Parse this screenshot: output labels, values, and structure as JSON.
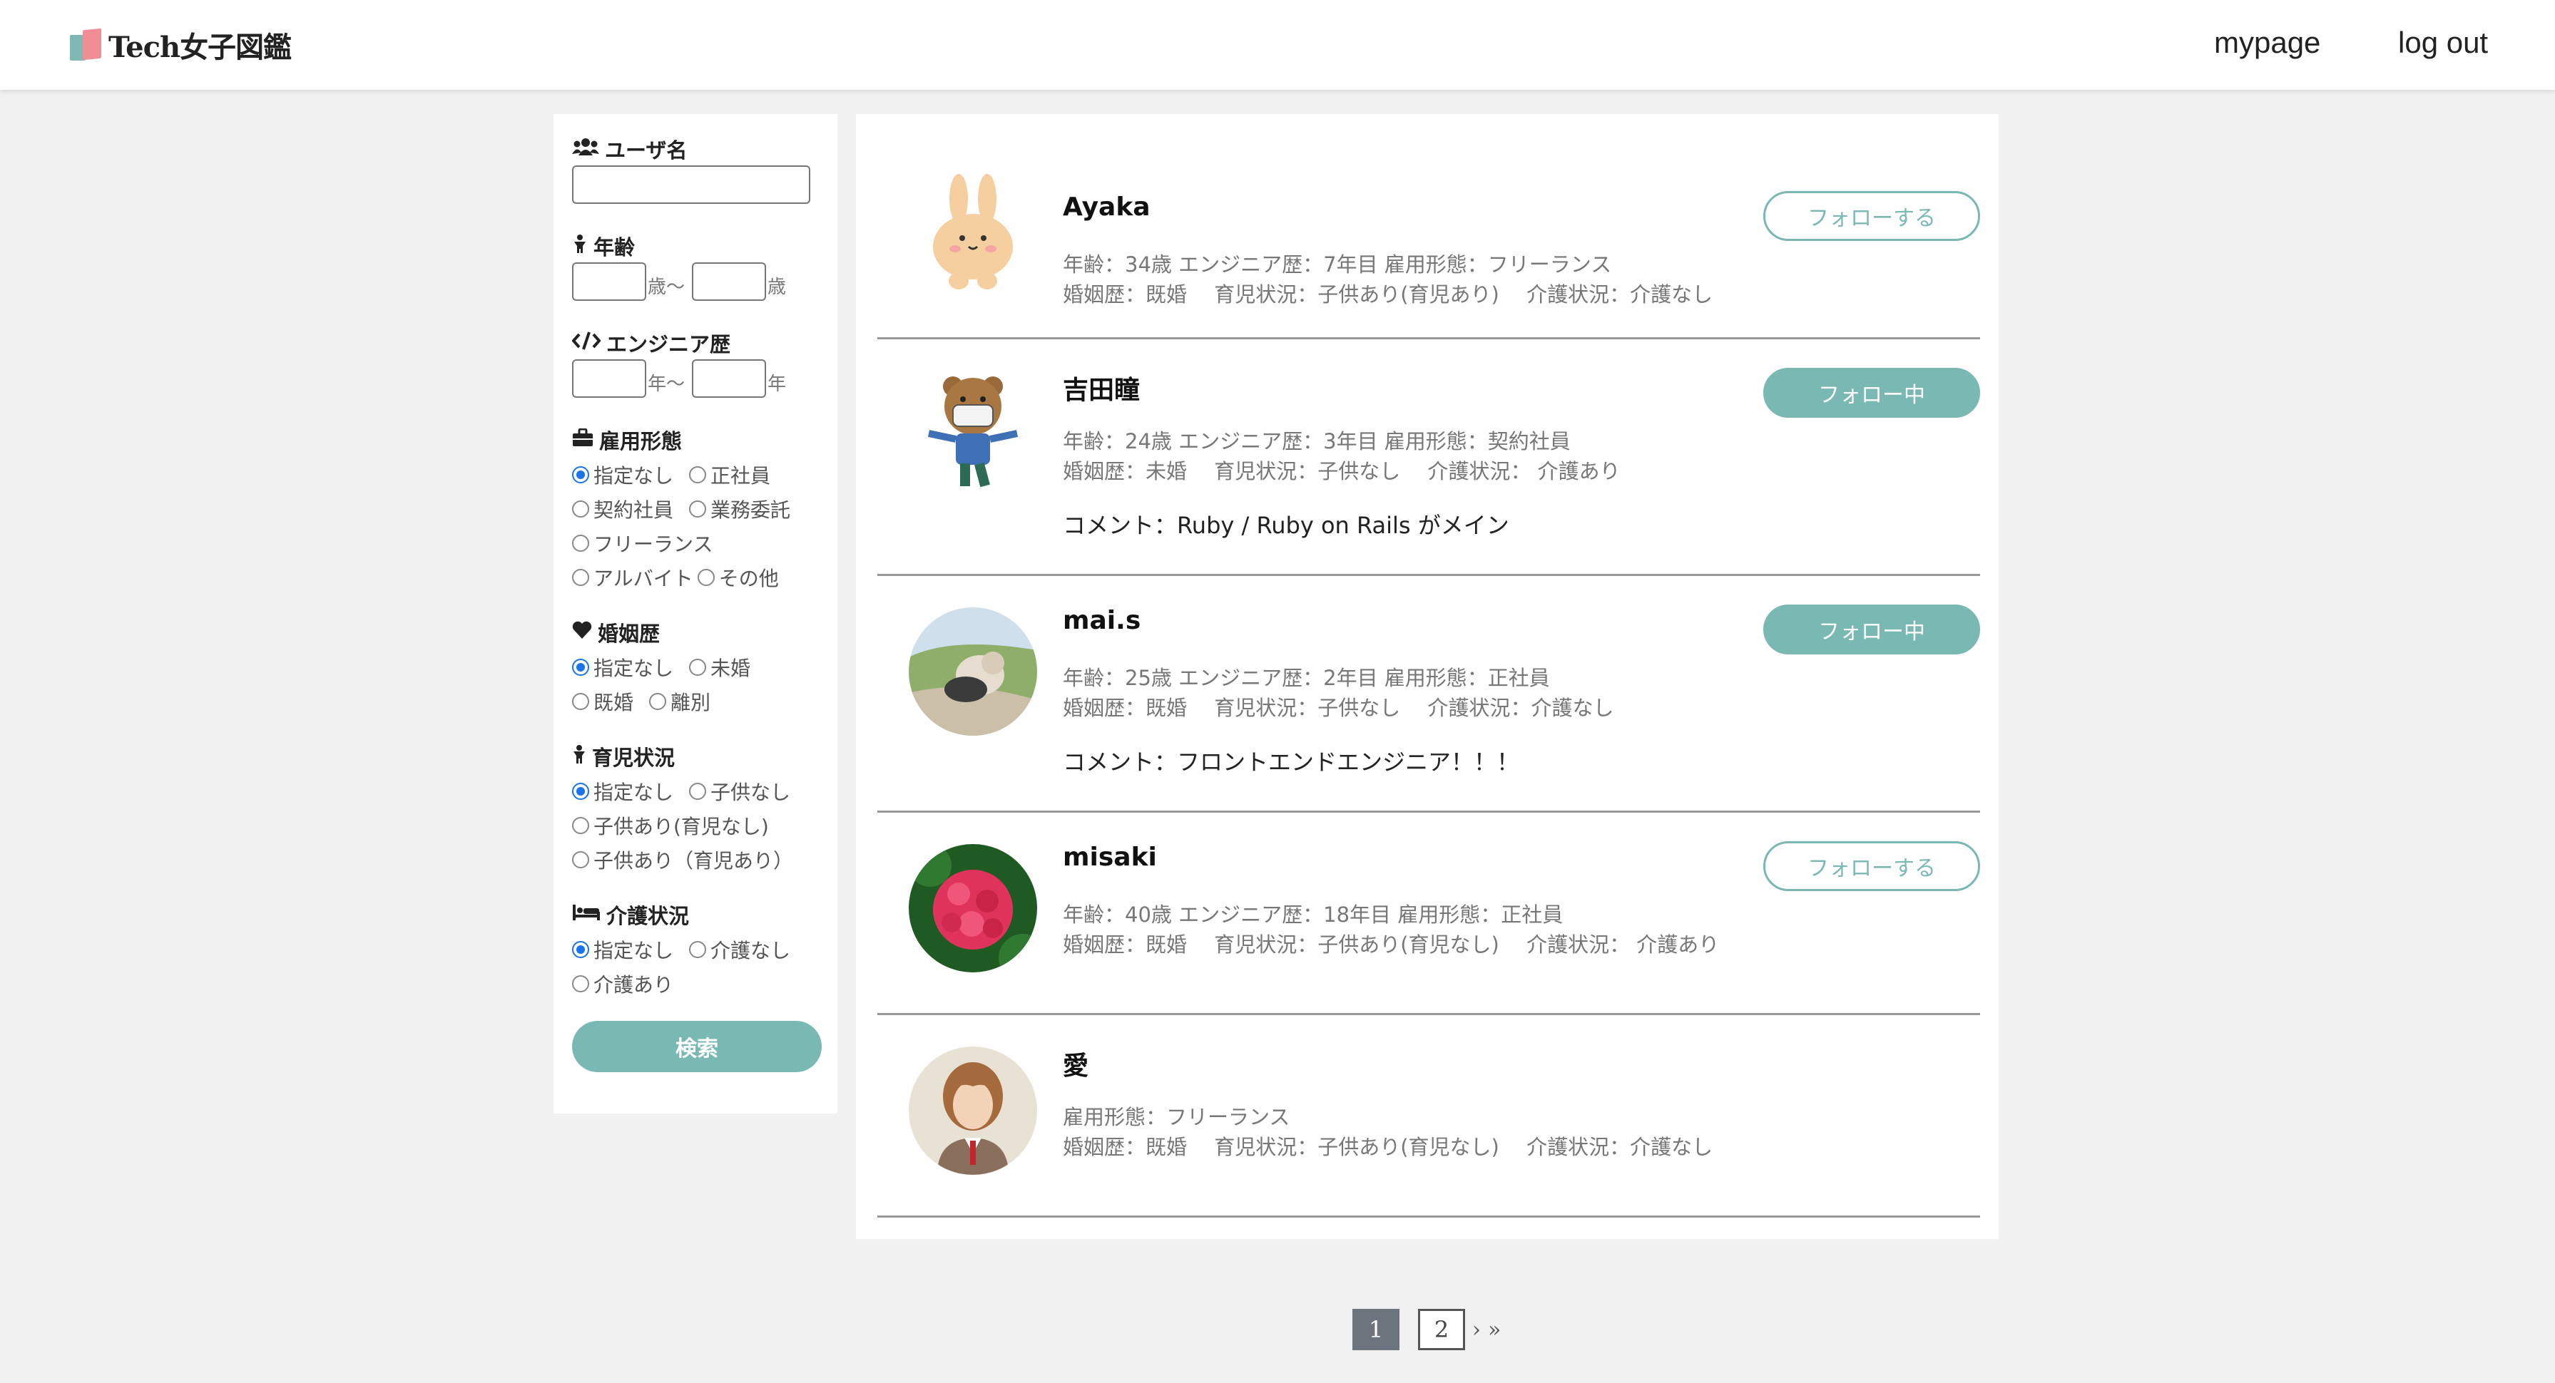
{
  "header": {
    "logo_text": "Tech女子図鑑",
    "mypage_label": "mypage",
    "logout_label": "log out"
  },
  "search": {
    "username_label": "ユーザ名",
    "age_label": "年齢",
    "age_unit_from": "歳〜",
    "age_unit_to": "歳",
    "engineer_label": "エンジニア歴",
    "eng_unit_from": "年〜",
    "eng_unit_to": "年",
    "employment_label": "雇用形態",
    "employment_options": [
      "指定なし",
      "正社員",
      "契約社員",
      "業務委託",
      "フリーランス",
      "アルバイト",
      "その他"
    ],
    "marriage_label": "婚姻歴",
    "marriage_options": [
      "指定なし",
      "未婚",
      "既婚",
      "離別"
    ],
    "childcare_label": "育児状況",
    "childcare_options": [
      "指定なし",
      "子供なし",
      "子供あり(育児なし)",
      "子供あり（育児あり）"
    ],
    "nursing_label": "介護状況",
    "nursing_options": [
      "指定なし",
      "介護なし",
      "介護あり"
    ],
    "button_label": "検索"
  },
  "users": [
    {
      "name": "Ayaka",
      "line1": "年齢：34歳 エンジニア歴：7年目 雇用形態：フリーランス",
      "line2": "婚姻歴：既婚　 育児状況：子供あり(育児あり)　 介護状況：介護なし",
      "comment": "",
      "follow_label": "フォローする",
      "following": false
    },
    {
      "name": "吉田瞳",
      "line1": "年齢：24歳 エンジニア歴：3年目 雇用形態：契約社員",
      "line2": "婚姻歴：未婚　 育児状況：子供なし　 介護状況： 介護あり",
      "comment": "コメント：Ruby / Ruby on Rails がメイン",
      "follow_label": "フォロー中",
      "following": true
    },
    {
      "name": "mai.s",
      "line1": "年齢：25歳 エンジニア歴：2年目 雇用形態：正社員",
      "line2": "婚姻歴：既婚　 育児状況：子供なし　 介護状況：介護なし",
      "comment": "コメント：フロントエンドエンジニア！！！",
      "follow_label": "フォロー中",
      "following": true
    },
    {
      "name": "misaki",
      "line1": "年齢：40歳 エンジニア歴：18年目 雇用形態：正社員",
      "line2": "婚姻歴：既婚　 育児状況：子供あり(育児なし)　 介護状況： 介護あり",
      "comment": "",
      "follow_label": "フォローする",
      "following": false
    },
    {
      "name": "愛",
      "line1": "雇用形態：フリーランス",
      "line2": "婚姻歴：既婚　 育児状況：子供あり(育児なし)　 介護状況：介護なし",
      "comment": "",
      "follow_label": "",
      "following": false
    }
  ],
  "pagination": {
    "current": "1",
    "next_page": "2",
    "next_arrow": "›",
    "last_arrow": "»"
  },
  "colors": {
    "accent": "#7ab8b3",
    "page_bg": "#f1f1f1",
    "radio_checked": "#1a73e8"
  }
}
